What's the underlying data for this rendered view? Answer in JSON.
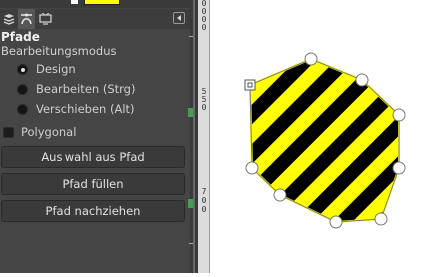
{
  "panel": {
    "title": "Pfade",
    "mode_label": "Bearbeitungsmodus",
    "modes": [
      {
        "label": "Design",
        "checked": true
      },
      {
        "label": "Bearbeiten (Strg)",
        "checked": false
      },
      {
        "label": "Verschieben (Alt)",
        "checked": false
      }
    ],
    "polygonal_label": "Polygonal",
    "buttons": {
      "selection_from_path": "Aus wahl aus  Pfad",
      "fill_path": "Pfad füllen",
      "stroke_path": "Pfad nachziehen"
    },
    "tabs": [
      "layers-icon",
      "paths-tool-icon",
      "device-status-icon"
    ]
  },
  "colors": {
    "foreground": "#ffffff",
    "background": "#ffff00",
    "stripe_a": "#ffff00",
    "stripe_b": "#000000",
    "anchor_fill": "#ffffff"
  },
  "ruler": {
    "labels": [
      "0",
      "0",
      "0",
      "0",
      "5",
      "5",
      "0",
      "7",
      "0",
      "0"
    ]
  }
}
